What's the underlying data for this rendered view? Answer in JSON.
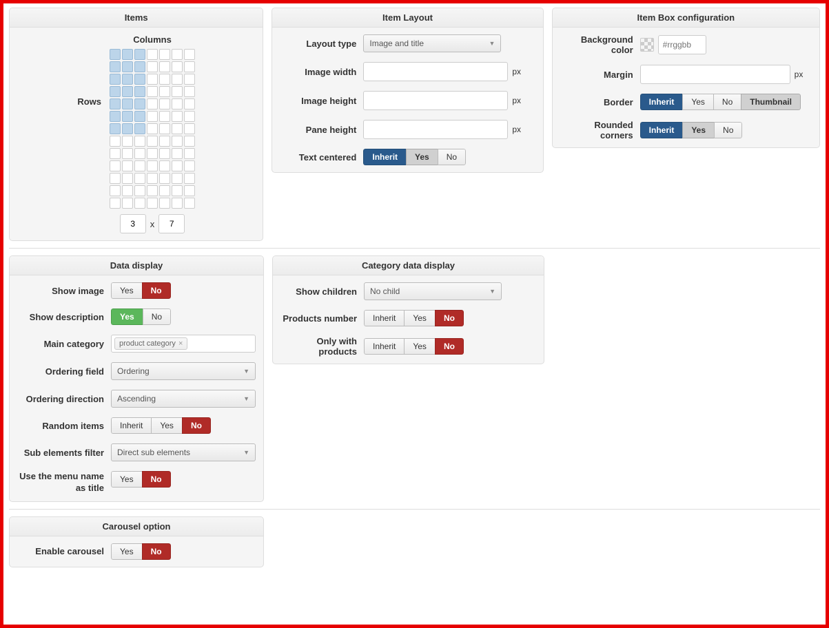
{
  "common": {
    "yes": "Yes",
    "no": "No",
    "inherit": "Inherit",
    "px": "px",
    "x": "x"
  },
  "items": {
    "title": "Items",
    "columns_label": "Columns",
    "rows_label": "Rows",
    "cols": "3",
    "rows": "7",
    "sel_cols": 3,
    "sel_rows": 7,
    "total_cols": 7,
    "total_rows": 13
  },
  "layout": {
    "title": "Item Layout",
    "type_label": "Layout type",
    "type_value": "Image and title",
    "img_w_label": "Image width",
    "img_h_label": "Image height",
    "pane_h_label": "Pane height",
    "centered_label": "Text centered"
  },
  "box": {
    "title": "Item Box configuration",
    "bg_label": "Background color",
    "bg_placeholder": "#rrggbb",
    "margin_label": "Margin",
    "border_label": "Border",
    "thumb": "Thumbnail",
    "rounded_label": "Rounded corners"
  },
  "data": {
    "title": "Data display",
    "show_img_label": "Show image",
    "show_desc_label": "Show description",
    "main_cat_label": "Main category",
    "main_cat_tag": "product category",
    "order_field_label": "Ordering field",
    "order_field_value": "Ordering",
    "order_dir_label": "Ordering direction",
    "order_dir_value": "Ascending",
    "random_label": "Random items",
    "sub_filter_label": "Sub elements filter",
    "sub_filter_value": "Direct sub elements",
    "menu_title_label": "Use the menu name as title"
  },
  "cat": {
    "title": "Category data display",
    "children_label": "Show children",
    "children_value": "No child",
    "products_num_label": "Products number",
    "only_prod_label": "Only with products"
  },
  "carousel": {
    "title": "Carousel option",
    "enable_label": "Enable carousel"
  }
}
